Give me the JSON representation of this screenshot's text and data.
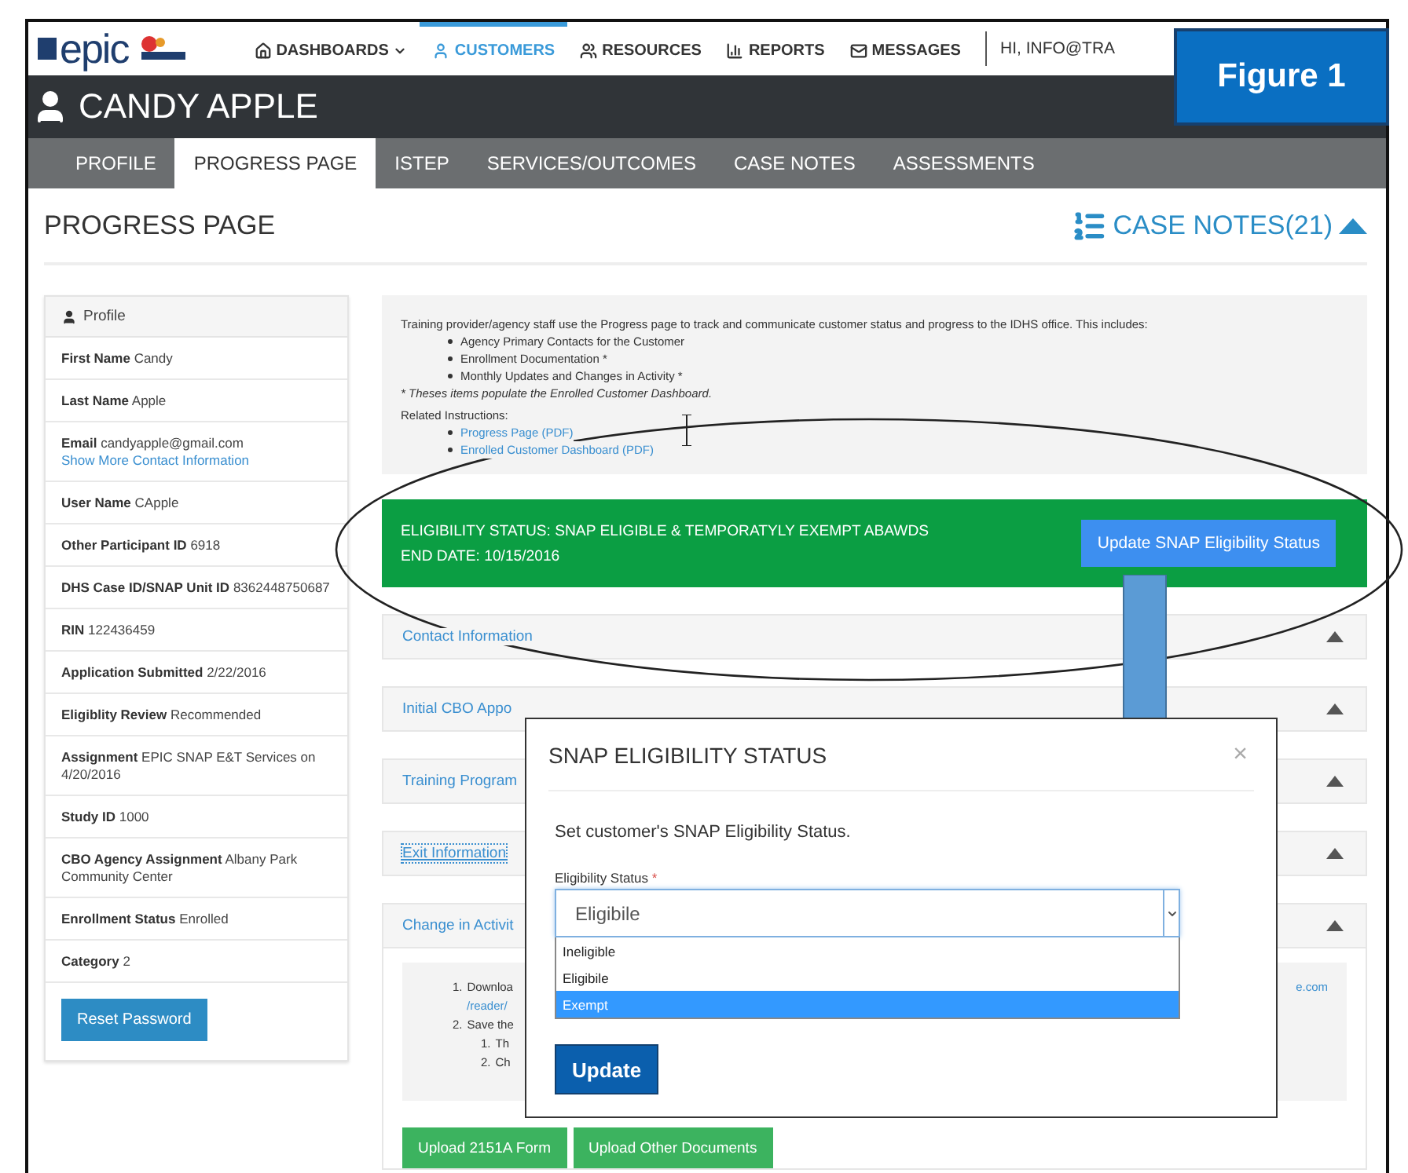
{
  "nav": {
    "logo": "epic",
    "items": [
      {
        "label": "DASHBOARDS",
        "dropdown": true,
        "selected": false
      },
      {
        "label": "CUSTOMERS",
        "dropdown": false,
        "selected": true
      },
      {
        "label": "RESOURCES",
        "dropdown": false,
        "selected": false
      },
      {
        "label": "REPORTS",
        "dropdown": false,
        "selected": false
      },
      {
        "label": "MESSAGES",
        "dropdown": false,
        "selected": false
      }
    ],
    "greeting": "HI, INFO@TRA"
  },
  "figure_label": "Figure 1",
  "customer_name": "CANDY APPLE",
  "tabs": [
    {
      "label": "PROFILE",
      "selected": false
    },
    {
      "label": "PROGRESS PAGE",
      "selected": true
    },
    {
      "label": "ISTEP",
      "selected": false
    },
    {
      "label": "SERVICES/OUTCOMES",
      "selected": false
    },
    {
      "label": "CASE NOTES",
      "selected": false
    },
    {
      "label": "ASSESSMENTS",
      "selected": false
    }
  ],
  "page_title": "PROGRESS PAGE",
  "case_notes": {
    "label": "CASE NOTES(21)",
    "expanded": true
  },
  "profile": {
    "title": "Profile",
    "fields": [
      {
        "label": "First Name",
        "value": "Candy"
      },
      {
        "label": "Last Name",
        "value": "Apple"
      },
      {
        "label": "Email",
        "value": "candyapple@gmail.com",
        "link": "Show More Contact Information"
      },
      {
        "label": "User Name",
        "value": "CApple"
      },
      {
        "label": "Other Participant ID",
        "value": "6918"
      },
      {
        "label": "DHS Case ID/SNAP Unit ID",
        "value": "8362448750687"
      },
      {
        "label": "RIN",
        "value": "122436459"
      },
      {
        "label": "Application Submitted",
        "value": "2/22/2016"
      },
      {
        "label": "Eligiblity Review",
        "value": "Recommended"
      },
      {
        "label": "Assignment",
        "value": "EPIC SNAP E&T Services on 4/20/2016"
      },
      {
        "label": "Study ID",
        "value": "1000"
      },
      {
        "label": "CBO Agency Assignment",
        "value": "Albany Park Community Center"
      },
      {
        "label": "Enrollment Status",
        "value": "Enrolled"
      },
      {
        "label": "Category",
        "value": "2"
      }
    ],
    "button": "Reset Password"
  },
  "intro": {
    "text": "Training provider/agency staff use the Progress page to track and communicate customer status and progress to the IDHS office. This includes:",
    "items": [
      "Agency Primary Contacts for the Customer",
      "Enrollment Documentation *",
      "Monthly Updates and Changes in Activity *"
    ],
    "note": "* Theses items populate the Enrolled Customer Dashboard.",
    "related_label": "Related Instructions:",
    "links": [
      "Progress Page (PDF)",
      "Enrolled Customer Dashboard (PDF)"
    ]
  },
  "eligibility": {
    "status": "ELIGIBILITY STATUS: SNAP ELIGIBLE & TEMPORATYLY EXEMPT ABAWDS",
    "end_date": "END DATE: 10/15/2016",
    "button": "Update SNAP Eligibility Status"
  },
  "sections": [
    {
      "title": "Contact Information"
    },
    {
      "title": "Initial CBO Appo"
    },
    {
      "title": "Training Program"
    },
    {
      "title": "Exit Information"
    },
    {
      "title": "Change in Activit"
    }
  ],
  "activity": {
    "steps": [
      {
        "num": "1.",
        "text": "Downloa",
        "link": "/reader/",
        "link_end": "e.com"
      },
      {
        "num": "2.",
        "text": "Save the",
        "children": [
          {
            "num": "1.",
            "text": "Th"
          },
          {
            "num": "2.",
            "text": "Ch"
          }
        ]
      }
    ],
    "buttons": [
      "Upload 2151A Form",
      "Upload Other Documents"
    ]
  },
  "modal": {
    "title": "SNAP ELIGIBILITY STATUS",
    "close": "×",
    "message": "Set customer's SNAP Eligibility Status.",
    "field_label": "Eligibility Status",
    "required": "*",
    "value": "Eligibile",
    "options": [
      {
        "label": "Ineligible",
        "highlighted": false
      },
      {
        "label": "Eligibile",
        "highlighted": false
      },
      {
        "label": "Exempt",
        "highlighted": true
      }
    ],
    "button": "Update"
  }
}
